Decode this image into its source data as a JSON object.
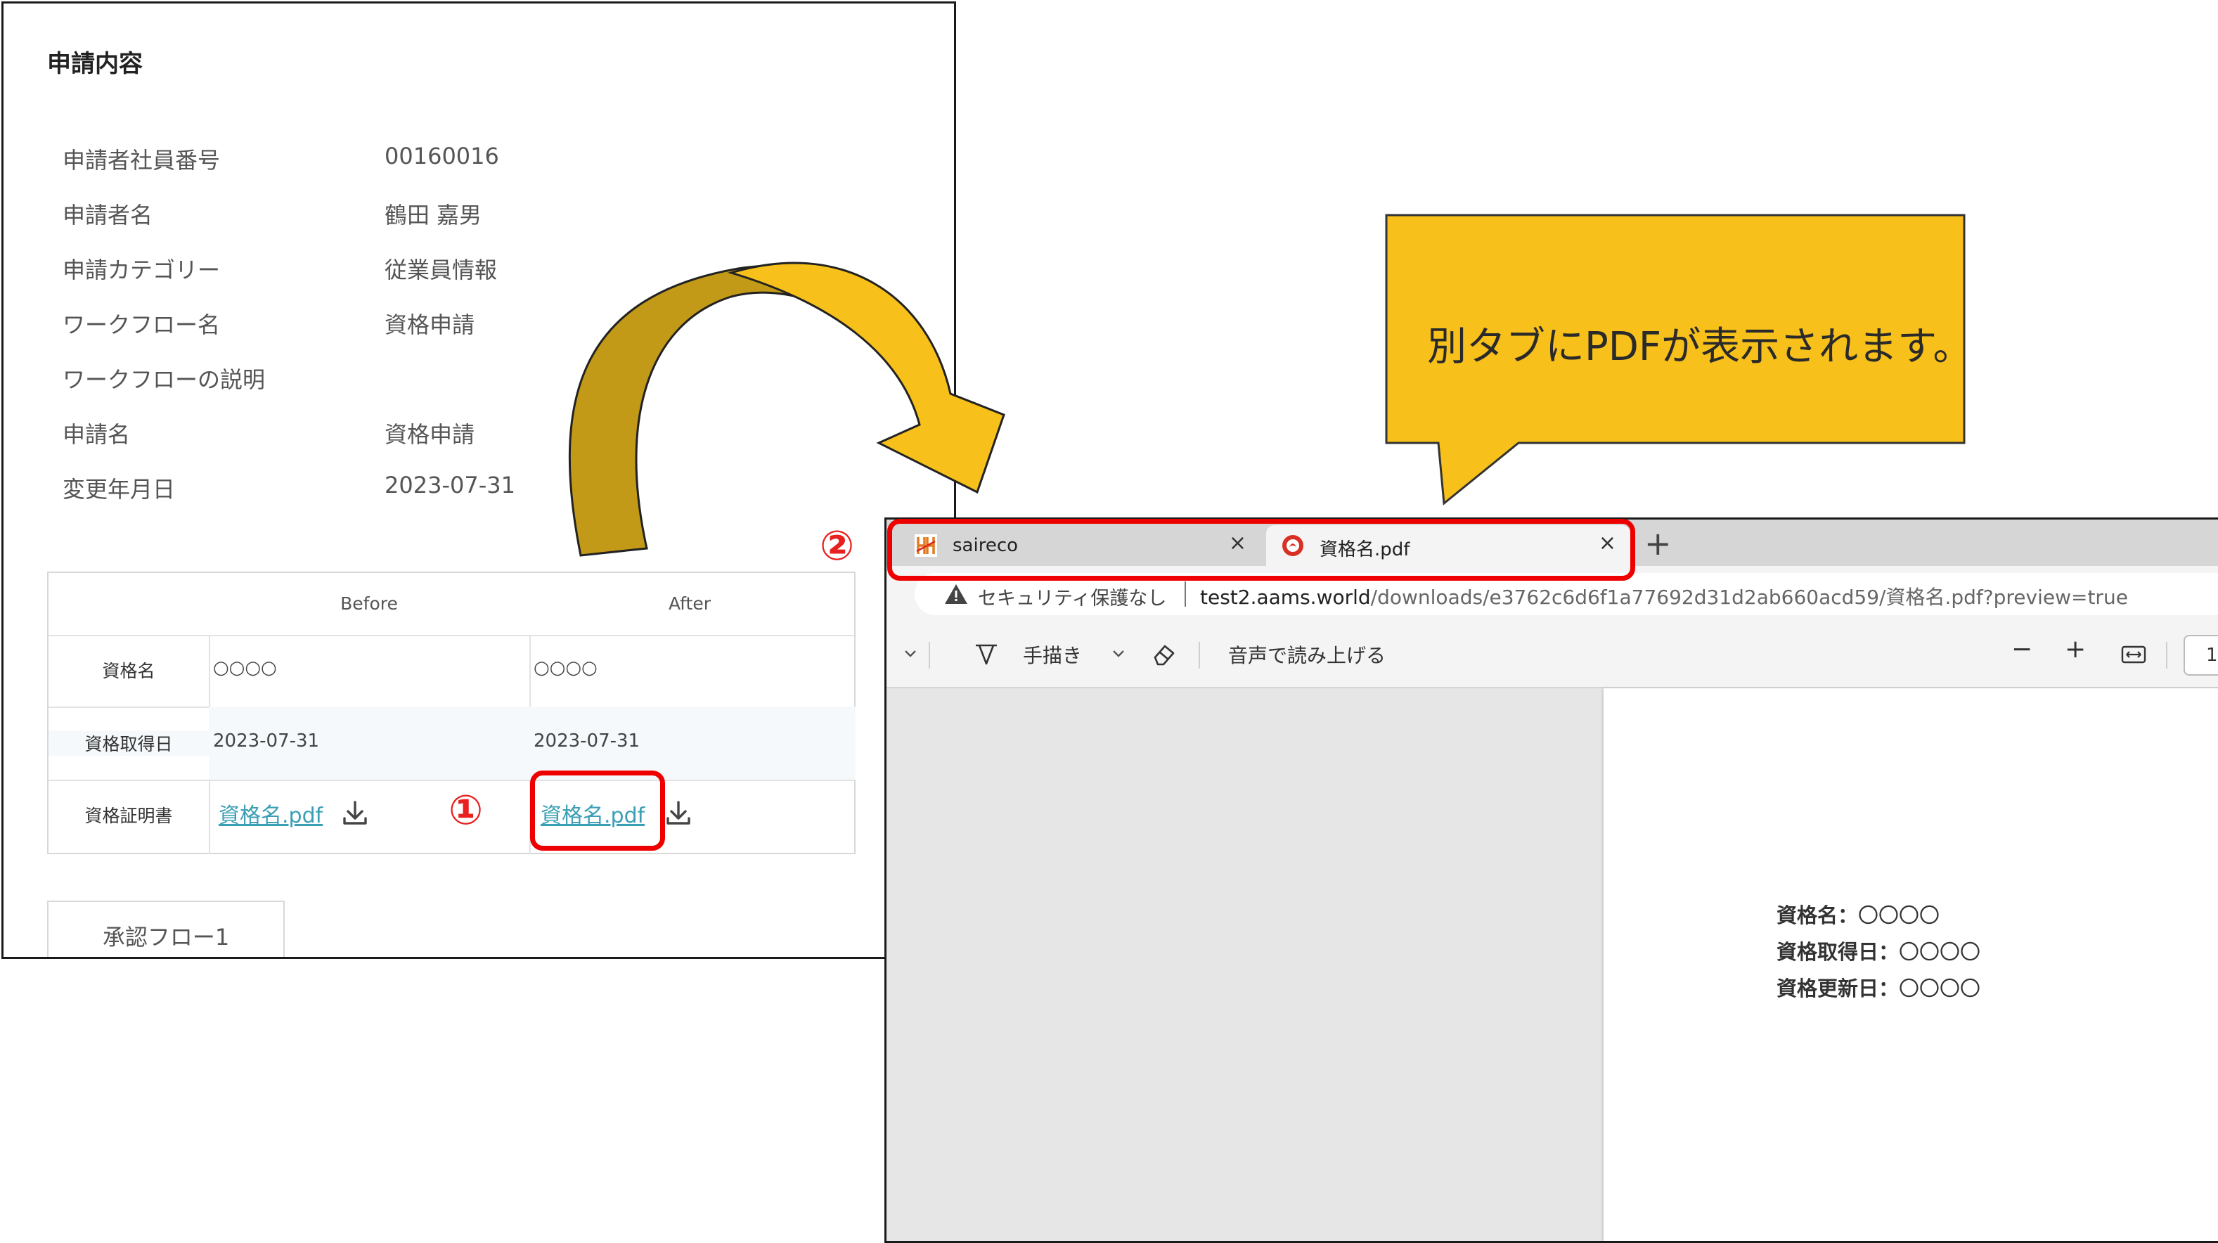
{
  "form": {
    "title": "申請内容",
    "fields": [
      {
        "label": "申請者社員番号",
        "value": "00160016"
      },
      {
        "label": "申請者名",
        "value": "鶴田 嘉男"
      },
      {
        "label": "申請カテゴリー",
        "value": "従業員情報"
      },
      {
        "label": "ワークフロー名",
        "value": "資格申請"
      },
      {
        "label": "ワークフローの説明",
        "value": ""
      },
      {
        "label": "申請名",
        "value": "資格申請"
      },
      {
        "label": "変更年月日",
        "value": "2023-07-31"
      }
    ],
    "comparison": {
      "headers": {
        "before": "Before",
        "after": "After"
      },
      "rows": [
        {
          "label": "資格名",
          "before": "○○○○",
          "after": "○○○○"
        },
        {
          "label": "資格取得日",
          "before": "2023-07-31",
          "after": "2023-07-31"
        },
        {
          "label": "資格証明書",
          "before": "資格名.pdf",
          "after": "資格名.pdf"
        }
      ]
    },
    "approval_tab": "承認フロー1"
  },
  "annotations": {
    "step1": "①",
    "step2": "②",
    "callout": "別タブにPDFが表示されます。",
    "highlight_color": "#ee0000",
    "callout_color": "#f7c01a"
  },
  "browser": {
    "tabs": [
      {
        "title": "saireco",
        "close": "×",
        "favicon": "saireco-logo-icon",
        "active": false
      },
      {
        "title": "資格名.pdf",
        "close": "×",
        "favicon": "pdf-icon",
        "active": true
      }
    ],
    "new_tab": "+",
    "security_text": "セキュリティ保護なし",
    "url_host": "test2.aams.world",
    "url_path": "/downloads/e3762c6d6f1a77692d31d2ab660acd59/資格名.pdf?preview=true",
    "toolbar": {
      "draw_label": "手描き",
      "read_aloud_label": "音声で読み上げる",
      "zoom_out": "−",
      "zoom_in": "+",
      "page_number": "1"
    },
    "pdf_content": [
      {
        "label": "資格名：",
        "value": "〇〇〇〇"
      },
      {
        "label": "資格取得日：",
        "value": "〇〇〇〇"
      },
      {
        "label": "資格更新日：",
        "value": "〇〇〇〇"
      }
    ]
  }
}
